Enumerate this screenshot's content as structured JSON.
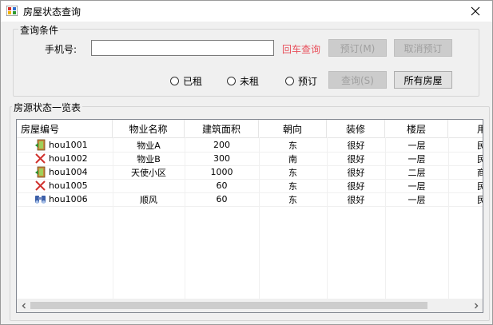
{
  "window": {
    "title": "房屋状态查询"
  },
  "query": {
    "legend": "查询条件",
    "phone_label": "手机号:",
    "phone_value": "",
    "enter_hint": "回车查询",
    "reserve_btn": "预订(M)",
    "cancel_btn": "取消预订",
    "query_btn": "查询(S)",
    "all_btn": "所有房屋",
    "radios": [
      "已租",
      "未租",
      "预订"
    ]
  },
  "list": {
    "legend": "房源状态一览表",
    "columns": [
      "房屋编号",
      "物业名称",
      "建筑面积",
      "朝向",
      "装修",
      "楼层",
      "用"
    ],
    "rows": [
      {
        "icon": "door-open-icon",
        "cells": [
          "hou1001",
          "物业A",
          "200",
          "东",
          "很好",
          "一层",
          "民"
        ]
      },
      {
        "icon": "red-x-icon",
        "cells": [
          "hou1002",
          "物业B",
          "300",
          "南",
          "很好",
          "一层",
          "民"
        ]
      },
      {
        "icon": "door-open-icon",
        "cells": [
          "hou1004",
          "天使小区",
          "1000",
          "东",
          "很好",
          "二层",
          "商"
        ]
      },
      {
        "icon": "red-x-icon",
        "cells": [
          "hou1005",
          "",
          "60",
          "东",
          "很好",
          "一层",
          "民"
        ]
      },
      {
        "icon": "binoculars-icon",
        "cells": [
          "hou1006",
          "顺风",
          "60",
          "东",
          "很好",
          "一层",
          "民"
        ]
      }
    ]
  },
  "colors": {
    "accent_red": "#e8505b",
    "door_green": "#2f8f2f",
    "x_red": "#d0312d"
  }
}
